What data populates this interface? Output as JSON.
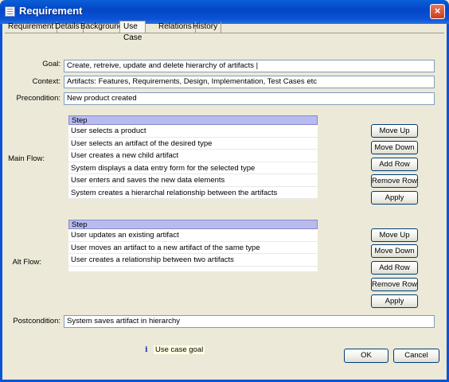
{
  "window": {
    "title": "Requirement",
    "close_icon": "×"
  },
  "tabs": [
    "Requirement",
    "Details",
    "Background",
    "Use Case",
    "Relations",
    "History"
  ],
  "active_tab": "Use Case",
  "form": {
    "goal_label": "Goal:",
    "goal_value": "Create, retreive, update and delete hierarchy of artifacts |",
    "context_label": "Context:",
    "context_value": "Artifacts: Features, Requirements, Design, Implementation, Test Cases etc",
    "precondition_label": "Precondition:",
    "precondition_value": "New product created",
    "postcondition_label": "Postcondition:",
    "postcondition_value": "System saves artifact in hierarchy"
  },
  "main_flow": {
    "label": "Main Flow:",
    "header": "Step",
    "rows": [
      "User selects a product",
      "User selects an artifact of the desired type",
      "User creates a new child artifact",
      "System displays a data entry form for the selected type",
      "User enters and saves the new data elements",
      "System creates a hierarchal relationship between the artifacts"
    ]
  },
  "alt_flow": {
    "label": "Alt Flow:",
    "header": "Step",
    "rows": [
      "User updates an existing artifact",
      "User moves an artifact to a new artifact of the same type",
      "User creates a relationship between two artifacts"
    ]
  },
  "buttons": {
    "move_up": "Move Up",
    "move_down": "Move Down",
    "add_row": "Add Row",
    "remove_row": "Remove Row",
    "apply": "Apply",
    "ok": "OK",
    "cancel": "Cancel"
  },
  "hint": {
    "icon": "i",
    "text": "Use case goal"
  }
}
